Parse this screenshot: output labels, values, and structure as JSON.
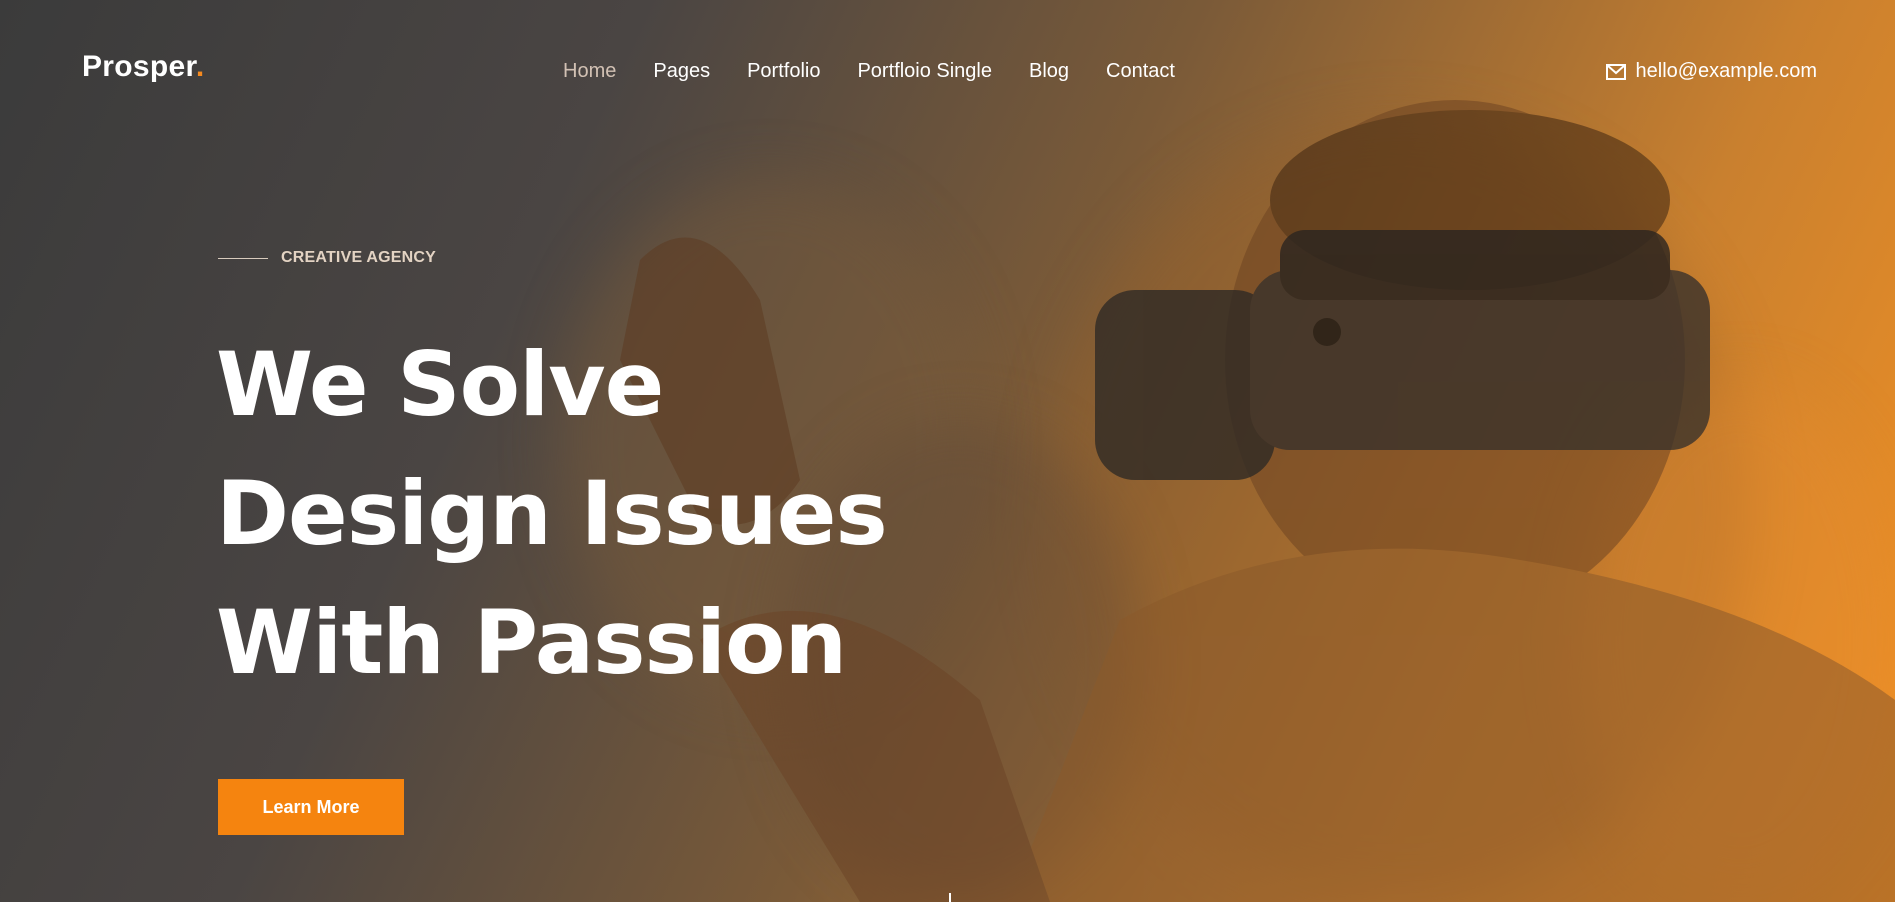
{
  "brand": {
    "name": "Prosper",
    "dot": "."
  },
  "nav": {
    "items": [
      {
        "label": "Home",
        "active": true
      },
      {
        "label": "Pages"
      },
      {
        "label": "Portfolio"
      },
      {
        "label": "Portfloio Single"
      },
      {
        "label": "Blog"
      },
      {
        "label": "Contact"
      }
    ]
  },
  "contact": {
    "email": "hello@example.com",
    "icon": "mail-icon"
  },
  "hero": {
    "kicker": "CREATIVE AGENCY",
    "headline_lines": [
      "We Solve",
      "Design Issues",
      "With Passion"
    ],
    "cta_label": "Learn More"
  },
  "colors": {
    "accent": "#f5840f",
    "gradient_start": "#3b3b3b",
    "gradient_end": "#f39123"
  }
}
